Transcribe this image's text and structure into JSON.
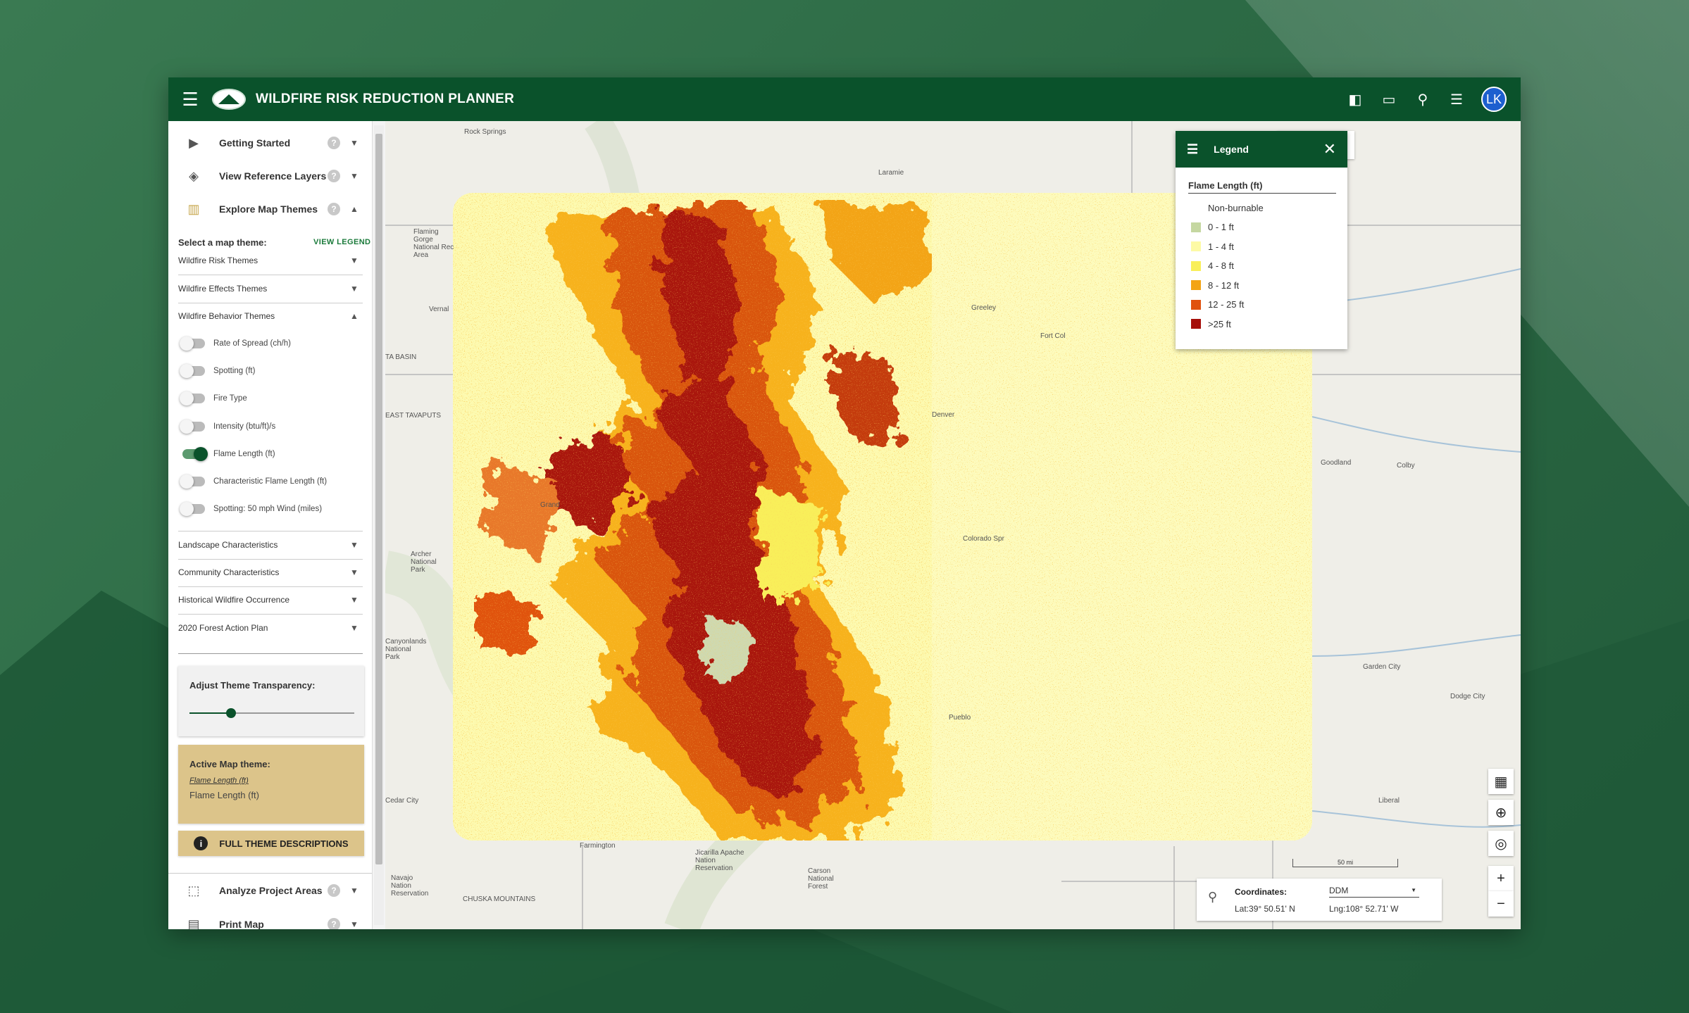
{
  "app": {
    "title": "WILDFIRE RISK REDUCTION PLANNER",
    "user_initials": "LK",
    "brand_color": "#0a522b"
  },
  "sidebar": {
    "sections": [
      {
        "label": "Getting Started",
        "icon": "play-icon",
        "expanded": false
      },
      {
        "label": "View Reference Layers",
        "icon": "layers-icon",
        "expanded": false
      },
      {
        "label": "Explore Map Themes",
        "icon": "map-icon",
        "expanded": true
      }
    ],
    "select_label": "Select a map theme:",
    "view_legend": "VIEW LEGEND",
    "theme_groups": [
      {
        "label": "Wildfire Risk Themes",
        "expanded": false
      },
      {
        "label": "Wildfire Effects Themes",
        "expanded": false
      },
      {
        "label": "Wildfire Behavior Themes",
        "expanded": true
      }
    ],
    "behavior_layers": [
      {
        "label": "Rate of Spread (ch/h)",
        "on": false
      },
      {
        "label": "Spotting (ft)",
        "on": false
      },
      {
        "label": "Fire Type",
        "on": false
      },
      {
        "label": "Intensity (btu/ft)/s",
        "on": false
      },
      {
        "label": "Flame Length (ft)",
        "on": true
      },
      {
        "label": "Characteristic Flame Length (ft)",
        "on": false
      },
      {
        "label": "Spotting: 50 mph Wind (miles)",
        "on": false
      }
    ],
    "other_groups": [
      {
        "label": "Landscape Characteristics"
      },
      {
        "label": "Community Characteristics"
      },
      {
        "label": "Historical Wildfire Occurrence"
      },
      {
        "label": "2020 Forest Action Plan"
      }
    ],
    "transparency": {
      "label": "Adjust Theme Transparency:",
      "value_fraction": 0.25
    },
    "active_theme": {
      "label": "Active Map theme:",
      "link": "Flame Length (ft)",
      "value": "Flame Length (ft)"
    },
    "full_descriptions": "FULL THEME DESCRIPTIONS",
    "bottom_sections": [
      {
        "label": "Analyze Project Areas",
        "icon": "select-area-icon"
      },
      {
        "label": "Print Map",
        "icon": "print-icon"
      }
    ]
  },
  "legend": {
    "header": "Legend",
    "title": "Flame Length (ft)",
    "items": [
      {
        "label": "Non-burnable",
        "color": ""
      },
      {
        "label": "0 - 1 ft",
        "color": "#c5d7a1"
      },
      {
        "label": "1 - 4 ft",
        "color": "#fdfaa6"
      },
      {
        "label": "4 - 8 ft",
        "color": "#f9ef5a"
      },
      {
        "label": "8 - 12 ft",
        "color": "#f3a414"
      },
      {
        "label": "12 - 25 ft",
        "color": "#e0520f"
      },
      {
        "label": ">25 ft",
        "color": "#a60f0a"
      }
    ]
  },
  "map": {
    "places": [
      "Rock Springs",
      "Laramie",
      "Vernal",
      "Greeley",
      "Fort Col",
      "Denver",
      "Goodland",
      "Colby",
      "Garden City",
      "Dodge City",
      "Liberal",
      "Farmington",
      "Pueblo",
      "Archer National Park",
      "Navajo Nation Reservation",
      "Flaming Gorge National Rec Area",
      "EAST TAVAPUTS",
      "TA BASIN",
      "CHUSKA MOUNTAINS",
      "Jicarilla Apache Nation Reservation",
      "Carson National Forest",
      "Canyonlands National Park",
      "Cedar City",
      "Grand",
      "Colorado Spr"
    ],
    "scale_label": "50 mi"
  },
  "coords": {
    "label": "Coordinates:",
    "format": "DDM",
    "lat": "Lat:39° 50.51' N",
    "lng": "Lng:108° 52.71' W"
  }
}
